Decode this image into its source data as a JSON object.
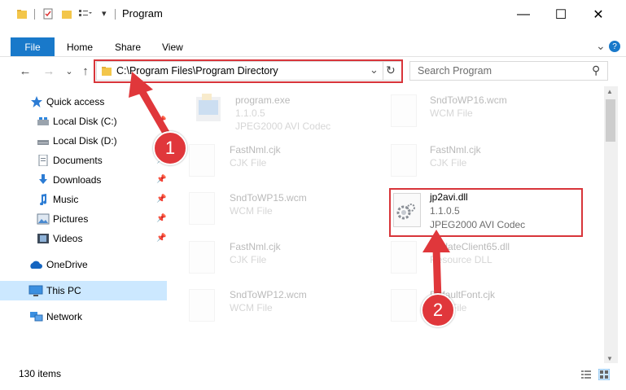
{
  "window": {
    "title": "Program",
    "min_glyph": "—",
    "max_glyph": "☐",
    "close_glyph": "✕"
  },
  "ribbon": {
    "tabs": [
      "File",
      "Home",
      "Share",
      "View"
    ],
    "expand_glyph": "⌄",
    "help_glyph": "?"
  },
  "nav": {
    "back_glyph": "←",
    "forward_glyph": "→",
    "recent_glyph": "⌄",
    "up_glyph": "↑",
    "address": "C:\\Program Files\\Program Directory",
    "dropdown_glyph": "⌄",
    "refresh_glyph": "↻",
    "search_placeholder": "Search Program",
    "search_icon_glyph": "⚲"
  },
  "sidebar": {
    "items": [
      {
        "label": "Quick access",
        "icon": "star-icon"
      },
      {
        "label": "Local Disk (C:)",
        "icon": "drive-icon"
      },
      {
        "label": "Local Disk (D:)",
        "icon": "drive-icon"
      },
      {
        "label": "Documents",
        "icon": "documents-icon"
      },
      {
        "label": "Downloads",
        "icon": "download-icon"
      },
      {
        "label": "Music",
        "icon": "music-icon"
      },
      {
        "label": "Pictures",
        "icon": "pictures-icon"
      },
      {
        "label": "Videos",
        "icon": "videos-icon"
      },
      {
        "label": "OneDrive",
        "icon": "cloud-icon"
      },
      {
        "label": "This PC",
        "icon": "computer-icon"
      },
      {
        "label": "Network",
        "icon": "network-icon"
      }
    ],
    "pin_glyph": "📌"
  },
  "files": {
    "left": [
      {
        "name": "program.exe",
        "line2": "1.1.0.5",
        "line3": "JPEG2000 AVI Codec"
      },
      {
        "name": "FastNml.cjk",
        "line2": "CJK File"
      },
      {
        "name": "SndToWP15.wcm",
        "line2": "WCM File"
      },
      {
        "name": "FastNml.cjk",
        "line2": "CJK File"
      },
      {
        "name": "SndToWP12.wcm",
        "line2": "WCM File"
      }
    ],
    "right": [
      {
        "name": "SndToWP16.wcm",
        "line2": "WCM File"
      },
      {
        "name": "FastNml.cjk",
        "line2": "CJK File"
      },
      {
        "name": "jp2avi.dll",
        "line2": "1.1.0.5",
        "line3": "JPEG2000 AVI Codec"
      },
      {
        "name": "UpdateClient65.dll",
        "line2": "Resource DLL"
      },
      {
        "name": "DefaultFont.cjk",
        "line2": "CJK File"
      }
    ]
  },
  "status": {
    "count": "130 items"
  },
  "annotations": {
    "badge1": "1",
    "badge2": "2",
    "color": "#d8353a"
  }
}
